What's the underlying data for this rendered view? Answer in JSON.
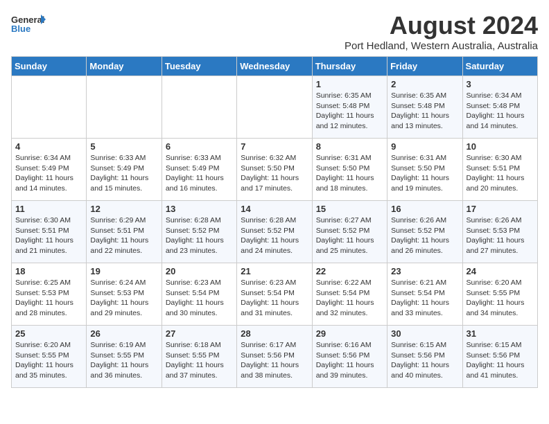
{
  "header": {
    "logo_general": "General",
    "logo_blue": "Blue",
    "title": "August 2024",
    "subtitle": "Port Hedland, Western Australia, Australia"
  },
  "calendar": {
    "days_of_week": [
      "Sunday",
      "Monday",
      "Tuesday",
      "Wednesday",
      "Thursday",
      "Friday",
      "Saturday"
    ],
    "weeks": [
      [
        {
          "day": "",
          "info": ""
        },
        {
          "day": "",
          "info": ""
        },
        {
          "day": "",
          "info": ""
        },
        {
          "day": "",
          "info": ""
        },
        {
          "day": "1",
          "info": "Sunrise: 6:35 AM\nSunset: 5:48 PM\nDaylight: 11 hours and 12 minutes."
        },
        {
          "day": "2",
          "info": "Sunrise: 6:35 AM\nSunset: 5:48 PM\nDaylight: 11 hours and 13 minutes."
        },
        {
          "day": "3",
          "info": "Sunrise: 6:34 AM\nSunset: 5:48 PM\nDaylight: 11 hours and 14 minutes."
        }
      ],
      [
        {
          "day": "4",
          "info": "Sunrise: 6:34 AM\nSunset: 5:49 PM\nDaylight: 11 hours and 14 minutes."
        },
        {
          "day": "5",
          "info": "Sunrise: 6:33 AM\nSunset: 5:49 PM\nDaylight: 11 hours and 15 minutes."
        },
        {
          "day": "6",
          "info": "Sunrise: 6:33 AM\nSunset: 5:49 PM\nDaylight: 11 hours and 16 minutes."
        },
        {
          "day": "7",
          "info": "Sunrise: 6:32 AM\nSunset: 5:50 PM\nDaylight: 11 hours and 17 minutes."
        },
        {
          "day": "8",
          "info": "Sunrise: 6:31 AM\nSunset: 5:50 PM\nDaylight: 11 hours and 18 minutes."
        },
        {
          "day": "9",
          "info": "Sunrise: 6:31 AM\nSunset: 5:50 PM\nDaylight: 11 hours and 19 minutes."
        },
        {
          "day": "10",
          "info": "Sunrise: 6:30 AM\nSunset: 5:51 PM\nDaylight: 11 hours and 20 minutes."
        }
      ],
      [
        {
          "day": "11",
          "info": "Sunrise: 6:30 AM\nSunset: 5:51 PM\nDaylight: 11 hours and 21 minutes."
        },
        {
          "day": "12",
          "info": "Sunrise: 6:29 AM\nSunset: 5:51 PM\nDaylight: 11 hours and 22 minutes."
        },
        {
          "day": "13",
          "info": "Sunrise: 6:28 AM\nSunset: 5:52 PM\nDaylight: 11 hours and 23 minutes."
        },
        {
          "day": "14",
          "info": "Sunrise: 6:28 AM\nSunset: 5:52 PM\nDaylight: 11 hours and 24 minutes."
        },
        {
          "day": "15",
          "info": "Sunrise: 6:27 AM\nSunset: 5:52 PM\nDaylight: 11 hours and 25 minutes."
        },
        {
          "day": "16",
          "info": "Sunrise: 6:26 AM\nSunset: 5:52 PM\nDaylight: 11 hours and 26 minutes."
        },
        {
          "day": "17",
          "info": "Sunrise: 6:26 AM\nSunset: 5:53 PM\nDaylight: 11 hours and 27 minutes."
        }
      ],
      [
        {
          "day": "18",
          "info": "Sunrise: 6:25 AM\nSunset: 5:53 PM\nDaylight: 11 hours and 28 minutes."
        },
        {
          "day": "19",
          "info": "Sunrise: 6:24 AM\nSunset: 5:53 PM\nDaylight: 11 hours and 29 minutes."
        },
        {
          "day": "20",
          "info": "Sunrise: 6:23 AM\nSunset: 5:54 PM\nDaylight: 11 hours and 30 minutes."
        },
        {
          "day": "21",
          "info": "Sunrise: 6:23 AM\nSunset: 5:54 PM\nDaylight: 11 hours and 31 minutes."
        },
        {
          "day": "22",
          "info": "Sunrise: 6:22 AM\nSunset: 5:54 PM\nDaylight: 11 hours and 32 minutes."
        },
        {
          "day": "23",
          "info": "Sunrise: 6:21 AM\nSunset: 5:54 PM\nDaylight: 11 hours and 33 minutes."
        },
        {
          "day": "24",
          "info": "Sunrise: 6:20 AM\nSunset: 5:55 PM\nDaylight: 11 hours and 34 minutes."
        }
      ],
      [
        {
          "day": "25",
          "info": "Sunrise: 6:20 AM\nSunset: 5:55 PM\nDaylight: 11 hours and 35 minutes."
        },
        {
          "day": "26",
          "info": "Sunrise: 6:19 AM\nSunset: 5:55 PM\nDaylight: 11 hours and 36 minutes."
        },
        {
          "day": "27",
          "info": "Sunrise: 6:18 AM\nSunset: 5:55 PM\nDaylight: 11 hours and 37 minutes."
        },
        {
          "day": "28",
          "info": "Sunrise: 6:17 AM\nSunset: 5:56 PM\nDaylight: 11 hours and 38 minutes."
        },
        {
          "day": "29",
          "info": "Sunrise: 6:16 AM\nSunset: 5:56 PM\nDaylight: 11 hours and 39 minutes."
        },
        {
          "day": "30",
          "info": "Sunrise: 6:15 AM\nSunset: 5:56 PM\nDaylight: 11 hours and 40 minutes."
        },
        {
          "day": "31",
          "info": "Sunrise: 6:15 AM\nSunset: 5:56 PM\nDaylight: 11 hours and 41 minutes."
        }
      ]
    ]
  }
}
